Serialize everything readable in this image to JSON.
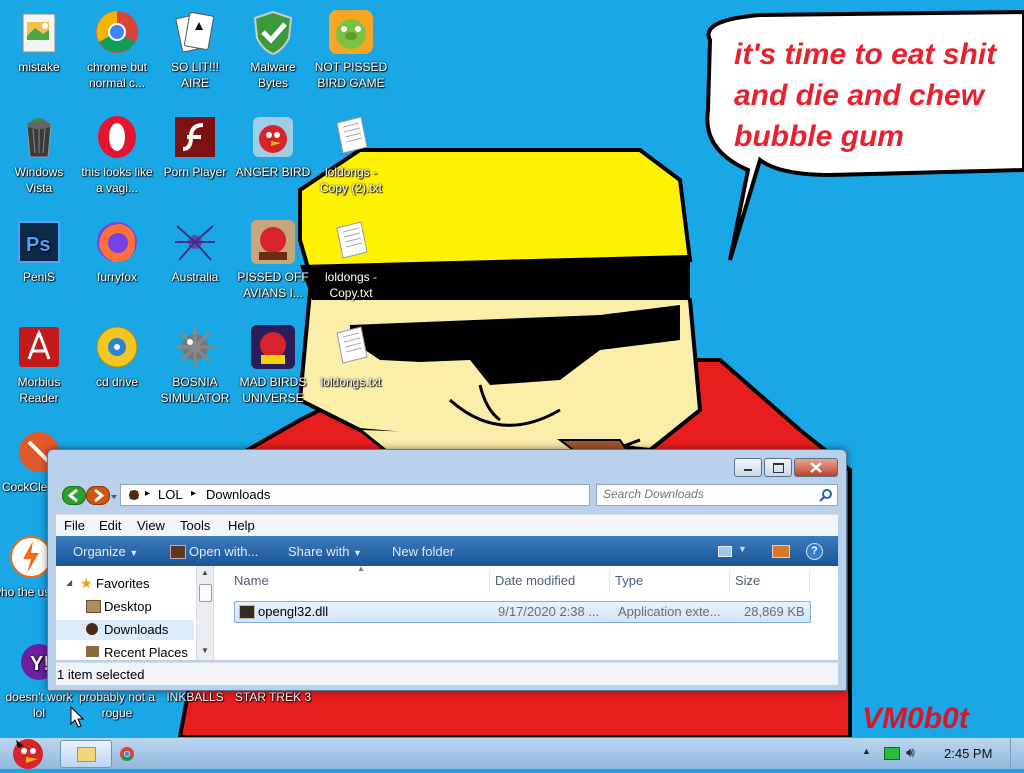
{
  "wallpaper": {
    "speech_bubble": [
      "it's time to eat shit",
      "and die and chew",
      "bubble gum"
    ],
    "signature": "VM0b0t"
  },
  "desktop_icons": [
    {
      "label": "mistake",
      "icon": "image-viewer-icon"
    },
    {
      "label": "chrome but normal c...",
      "icon": "chrome-icon"
    },
    {
      "label": "SO LIT!!! AIRE",
      "icon": "solitaire-icon"
    },
    {
      "label": "Malware Bytes",
      "icon": "shield-check-icon"
    },
    {
      "label": "NOT PISSED BIRD GAME",
      "icon": "green-pig-icon"
    },
    {
      "label": "Windows Vista",
      "icon": "recycle-bin-icon"
    },
    {
      "label": "this looks like a vagi...",
      "icon": "opera-icon"
    },
    {
      "label": "Porn Player",
      "icon": "flash-icon"
    },
    {
      "label": "ANGER BIRD",
      "icon": "red-bird-icon"
    },
    {
      "label": "loldongs - Copy (2).txt",
      "icon": "text-file-icon"
    },
    {
      "label": "PeniS",
      "icon": "photoshop-icon"
    },
    {
      "label": "furryfox",
      "icon": "firefox-icon"
    },
    {
      "label": "Australia",
      "icon": "spider-solitaire-icon"
    },
    {
      "label": "PISSED OFF AVIANS I...",
      "icon": "seasons-bird-icon"
    },
    {
      "label": "loldongs - Copy.txt",
      "icon": "text-file-icon"
    },
    {
      "label": "Morbius Reader",
      "icon": "pdf-reader-icon"
    },
    {
      "label": "cd drive",
      "icon": "cd-icon"
    },
    {
      "label": "BOSNIA SIMULATOR",
      "icon": "mine-icon"
    },
    {
      "label": "MAD BIRDS UNIVERSE",
      "icon": "space-bird-icon"
    },
    {
      "label": "loldongs.txt",
      "icon": "text-file-icon"
    },
    {
      "label": "CockCle",
      "icon": "cleaner-icon"
    },
    {
      "label": "who the uses t",
      "icon": "lightning-icon"
    },
    {
      "label": "doesn't work lol",
      "icon": "yahoo-icon"
    },
    {
      "label": "probably not a rogue",
      "icon": "star-icon"
    },
    {
      "label": "INKBALLS",
      "icon": "toolbox-icon"
    },
    {
      "label": "STAR TREK 3",
      "icon": "red-bird-icon"
    }
  ],
  "explorer": {
    "breadcrumb": [
      "LOL",
      "Downloads"
    ],
    "search_placeholder": "Search Downloads",
    "menu": [
      "File",
      "Edit",
      "View",
      "Tools",
      "Help"
    ],
    "toolbar": [
      "Organize",
      "Open with...",
      "Share with",
      "New folder"
    ],
    "nav_pane": [
      "Favorites",
      "Desktop",
      "Downloads",
      "Recent Places"
    ],
    "columns": [
      "Name",
      "Date modified",
      "Type",
      "Size"
    ],
    "rows": [
      {
        "name": "opengl32.dll",
        "date": "9/17/2020 2:38 ...",
        "type": "Application exte...",
        "size": "28,869 KB"
      }
    ],
    "status": "1 item selected"
  },
  "taskbar": {
    "clock": "2:45 PM"
  }
}
